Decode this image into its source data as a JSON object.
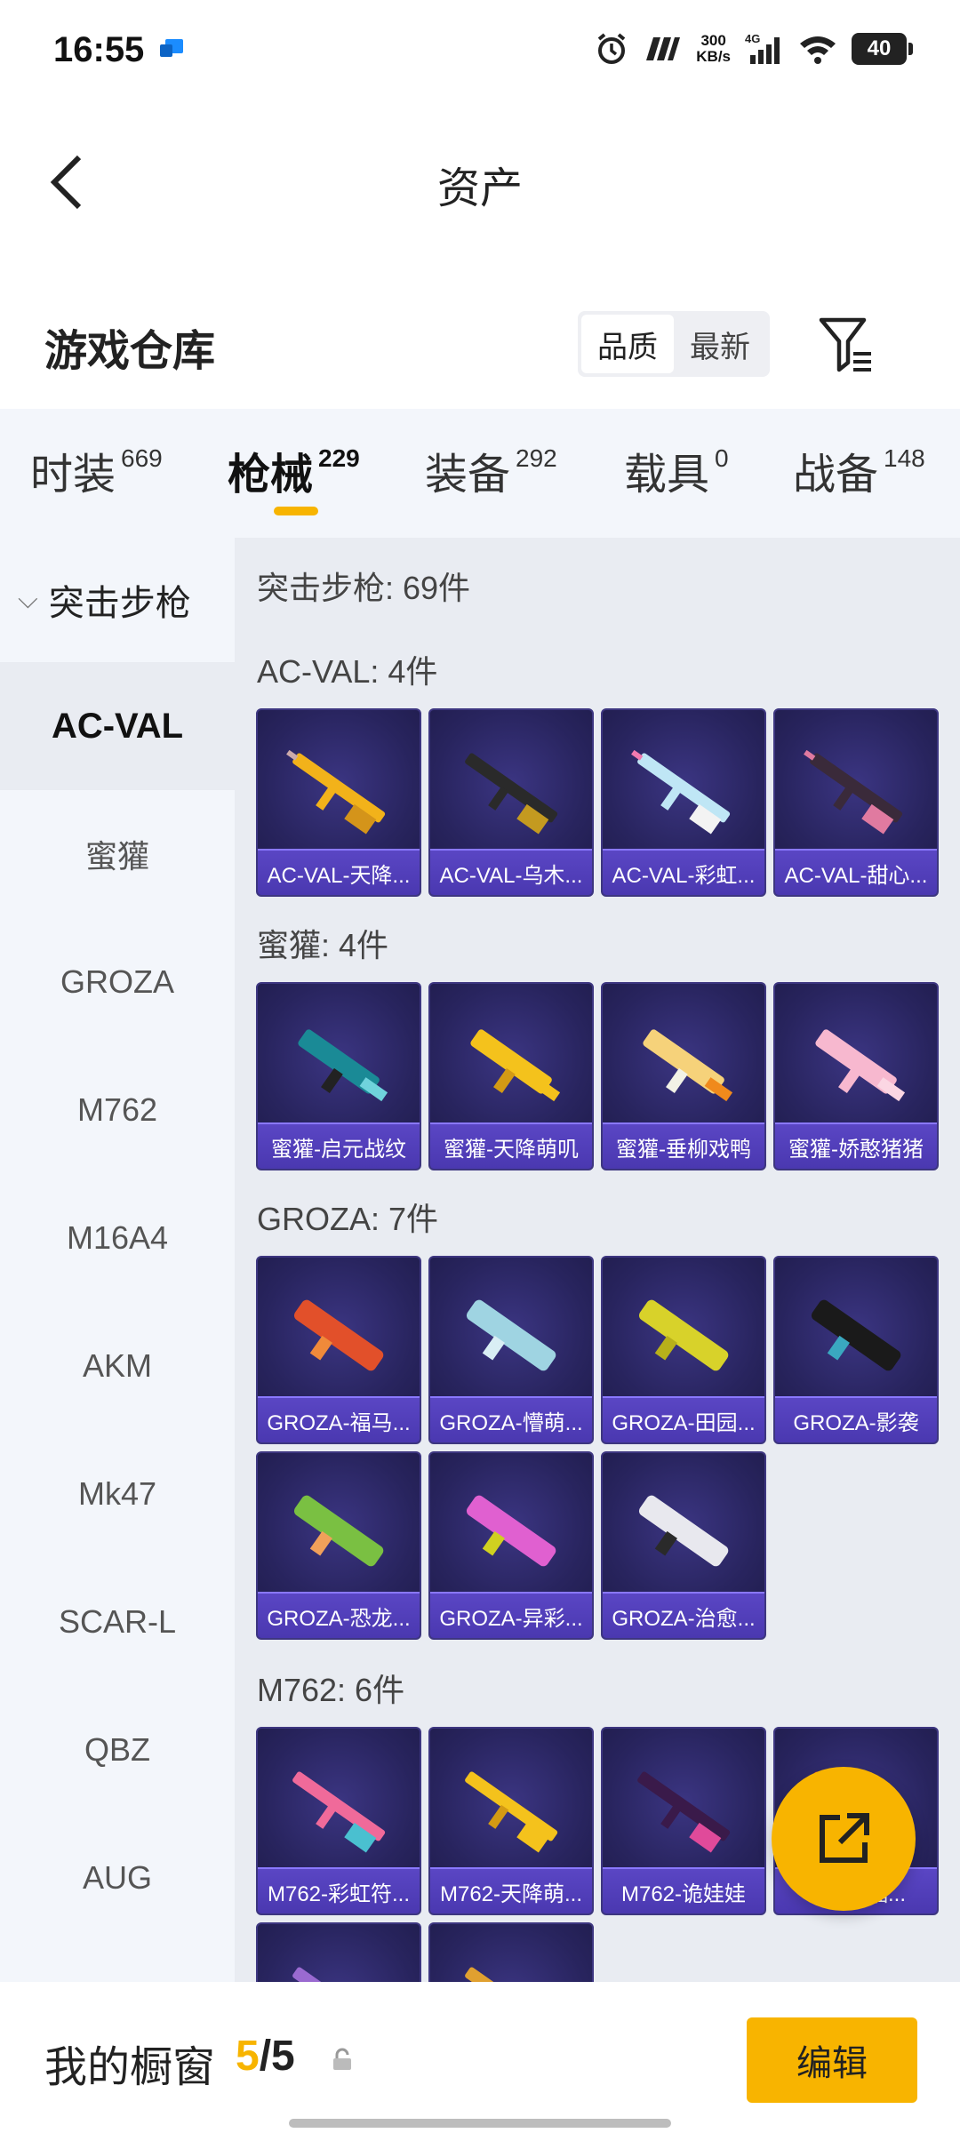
{
  "status_bar": {
    "time": "16:55",
    "net_speed_top": "300",
    "net_speed_unit": "KB/s",
    "network": "4G",
    "battery": "40"
  },
  "nav": {
    "title": "资产"
  },
  "warehouse": {
    "title": "游戏仓库",
    "sort_options": [
      "品质",
      "最新"
    ]
  },
  "tabs": [
    {
      "label": "时装",
      "count": "669"
    },
    {
      "label": "枪械",
      "count": "229"
    },
    {
      "label": "装备",
      "count": "292"
    },
    {
      "label": "载具",
      "count": "0"
    },
    {
      "label": "战备",
      "count": "148"
    }
  ],
  "sidebar": {
    "header": "突击步枪",
    "items": [
      "AC-VAL",
      "蜜獾",
      "GROZA",
      "M762",
      "M16A4",
      "AKM",
      "Mk47",
      "SCAR-L",
      "QBZ",
      "AUG"
    ]
  },
  "main": {
    "header": "突击步枪: 69件",
    "sections": [
      {
        "title": "AC-VAL: 4件",
        "items": [
          "AC-VAL-天降...",
          "AC-VAL-乌木...",
          "AC-VAL-彩虹...",
          "AC-VAL-甜心..."
        ]
      },
      {
        "title": "蜜獾: 4件",
        "items": [
          "蜜獾-启元战纹",
          "蜜獾-天降萌叽",
          "蜜獾-垂柳戏鸭",
          "蜜獾-娇憨猪猪"
        ]
      },
      {
        "title": "GROZA: 7件",
        "items": [
          "GROZA-福马...",
          "GROZA-懵萌...",
          "GROZA-田园...",
          "GROZA-影袭",
          "GROZA-恐龙...",
          "GROZA-异彩...",
          "GROZA-治愈..."
        ]
      },
      {
        "title": "M762: 6件",
        "items": [
          "M762-彩虹符...",
          "M762-天降萌...",
          "M762-诡娃娃",
          "M762-福..."
        ]
      }
    ]
  },
  "bottom": {
    "label": "我的橱窗",
    "current": "5",
    "separator": "/",
    "total": "5",
    "edit_label": "编辑"
  },
  "colors": {
    "accent": "#f8b400",
    "card_bg": "#28245e",
    "card_label": "#4a38b0"
  }
}
